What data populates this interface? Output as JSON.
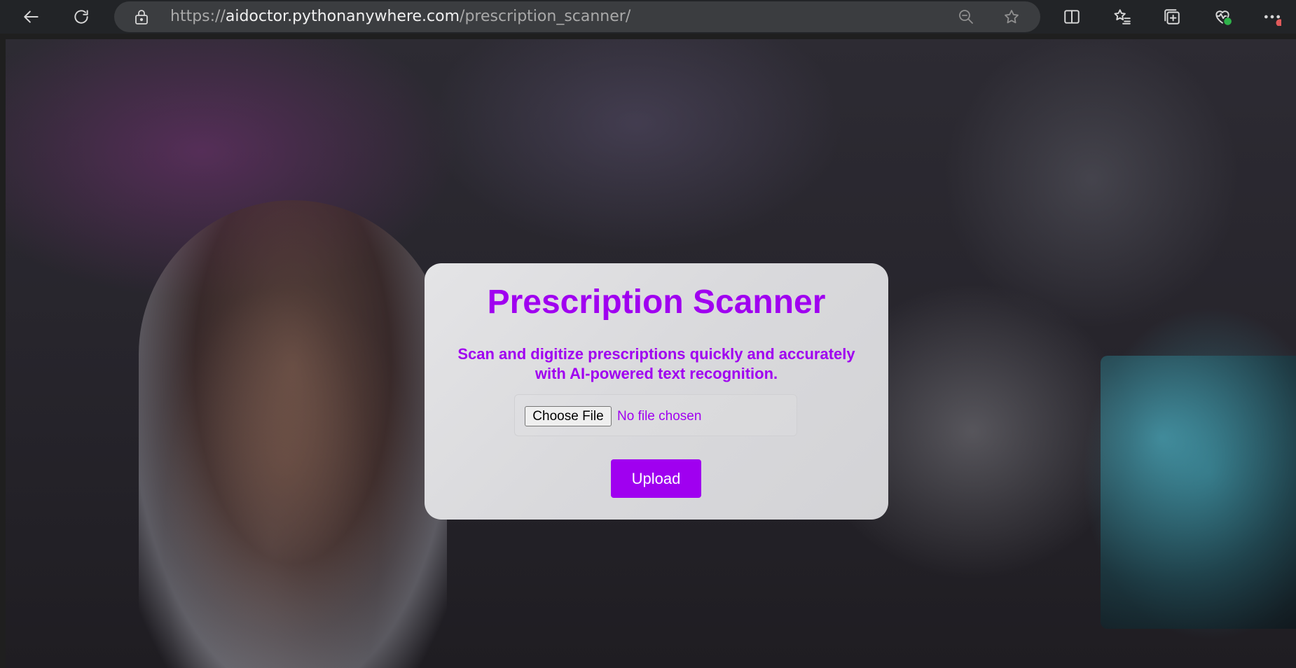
{
  "browser": {
    "url_prefix": "https://",
    "url_host": "aidoctor.pythonanywhere.com",
    "url_path": "/prescription_scanner/",
    "icons": [
      "back-arrow-icon",
      "refresh-icon",
      "lock-icon",
      "zoom-out-icon",
      "favorite-star-icon",
      "split-screen-icon",
      "favorites-list-icon",
      "collections-icon",
      "browser-essentials-icon",
      "more-menu-icon"
    ]
  },
  "card": {
    "title": "Prescription Scanner",
    "subtitle_line1": "Scan and digitize prescriptions quickly and accurately",
    "subtitle_line2": "with AI-powered text recognition.",
    "choose_file_label": "Choose File",
    "file_status": "No file chosen",
    "upload_label": "Upload"
  },
  "colors": {
    "accent": "#a000f0",
    "toolbar_bg": "#222427",
    "addressbar_bg": "#3b3d40"
  }
}
